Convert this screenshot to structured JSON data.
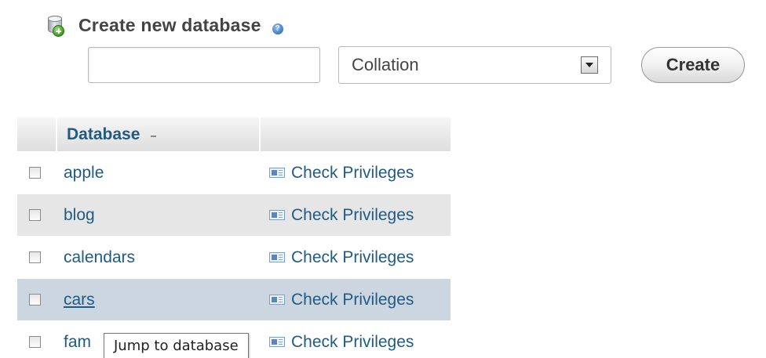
{
  "create_section": {
    "title": "Create new database",
    "icons": {
      "heading_icon": "database-add-icon",
      "help_icon": "help-icon"
    },
    "name_input": {
      "value": "",
      "placeholder": ""
    },
    "collation_select": {
      "selected": "Collation"
    },
    "create_button_label": "Create"
  },
  "table": {
    "header": {
      "database_label": "Database",
      "sort_indicator": "sort-ascending-icon"
    },
    "rows": [
      {
        "name": "apple",
        "action": "Check Privileges",
        "checked": false
      },
      {
        "name": "blog",
        "action": "Check Privileges",
        "checked": false
      },
      {
        "name": "calendars",
        "action": "Check Privileges",
        "checked": false
      },
      {
        "name": "cars",
        "action": "Check Privileges",
        "checked": false,
        "hovered": true
      },
      {
        "name": "fam",
        "action": "Check Privileges",
        "checked": false
      }
    ]
  },
  "tooltip": {
    "text": "Jump to database"
  },
  "colors": {
    "link": "#235a81",
    "row_alt": "#e6e6e6",
    "row_hover": "#cbd6e1"
  }
}
